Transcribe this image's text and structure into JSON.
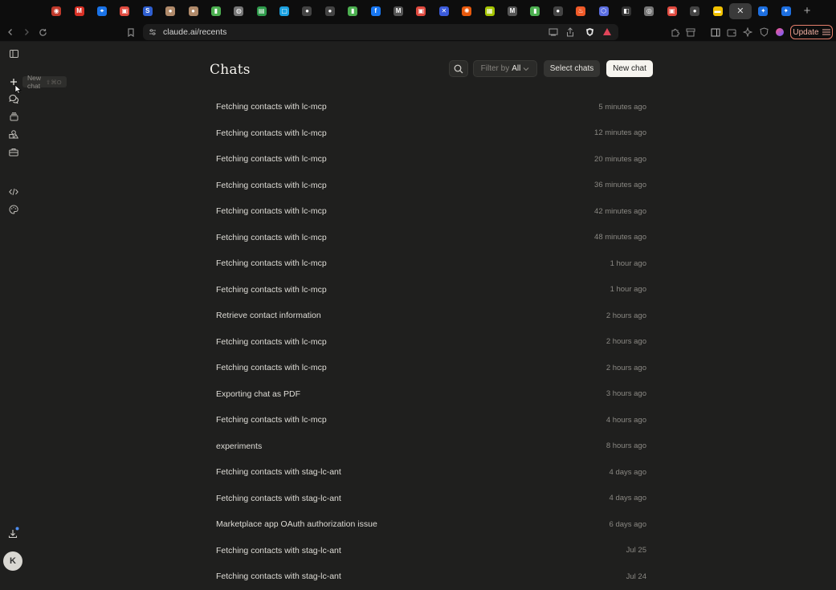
{
  "browser": {
    "url": "claude.ai/recents",
    "update_label": "Update",
    "tabs": [
      {
        "icon": "record-icon",
        "glyph": "◉",
        "color": "#c0392b"
      },
      {
        "icon": "gmail-icon",
        "glyph": "M",
        "color": "#d93025"
      },
      {
        "icon": "maps-pin-icon",
        "glyph": "⌖",
        "color": "#1a73e8"
      },
      {
        "icon": "calendar-icon",
        "glyph": "▣",
        "color": "#e04a3f"
      },
      {
        "icon": "doc-icon",
        "glyph": "S",
        "color": "#2f5fd0"
      },
      {
        "icon": "avatar-favicon-icon",
        "glyph": "●",
        "color": "#b08a6a"
      },
      {
        "icon": "avatar-favicon-icon",
        "glyph": "●",
        "color": "#b08a6a"
      },
      {
        "icon": "chart-icon",
        "glyph": "▮",
        "color": "#4caf50"
      },
      {
        "icon": "globe-icon",
        "glyph": "◍",
        "color": "#777777"
      },
      {
        "icon": "calculator-icon",
        "glyph": "▤",
        "color": "#2e9b4b"
      },
      {
        "icon": "chat-bubble-icon",
        "glyph": "▢",
        "color": "#1aa0e0"
      },
      {
        "icon": "github-icon",
        "glyph": "●",
        "color": "#444444"
      },
      {
        "icon": "github-icon",
        "glyph": "●",
        "color": "#444444"
      },
      {
        "icon": "chart-icon",
        "glyph": "▮",
        "color": "#4caf50"
      },
      {
        "icon": "facebook-icon",
        "glyph": "f",
        "color": "#1877f2"
      },
      {
        "icon": "medium-icon",
        "glyph": "M",
        "color": "#555555"
      },
      {
        "icon": "calendar-icon",
        "glyph": "▣",
        "color": "#e04a3f"
      },
      {
        "icon": "x-app-icon",
        "glyph": "✕",
        "color": "#3b5bdb"
      },
      {
        "icon": "gear-app-icon",
        "glyph": "✺",
        "color": "#e8590c"
      },
      {
        "icon": "sticky-icon",
        "glyph": "▦",
        "color": "#a4c400"
      },
      {
        "icon": "medium-icon",
        "glyph": "M",
        "color": "#555555"
      },
      {
        "icon": "chart-icon",
        "glyph": "▮",
        "color": "#4caf50"
      },
      {
        "icon": "github-icon",
        "glyph": "●",
        "color": "#444444"
      },
      {
        "icon": "fire-icon",
        "glyph": "♨",
        "color": "#f05a28"
      },
      {
        "icon": "hexagon-icon",
        "glyph": "⬡",
        "color": "#5b6ee1"
      },
      {
        "icon": "box-icon",
        "glyph": "◧",
        "color": "#333333"
      },
      {
        "icon": "chat-app-icon",
        "glyph": "◎",
        "color": "#777777"
      },
      {
        "icon": "calendar-icon",
        "glyph": "▣",
        "color": "#e04a3f"
      },
      {
        "icon": "github-icon",
        "glyph": "●",
        "color": "#444444"
      },
      {
        "icon": "note-icon",
        "glyph": "▬",
        "color": "#f2c200"
      },
      {
        "icon": "close-icon",
        "glyph": "✕",
        "color": "#3a3a3a",
        "active": true
      },
      {
        "icon": "settings-app-icon",
        "glyph": "✦",
        "color": "#1d6fe0"
      },
      {
        "icon": "settings-app-icon",
        "glyph": "✦",
        "color": "#1d6fe0"
      }
    ]
  },
  "sidebar": {
    "tooltip_label": "New chat",
    "tooltip_shortcut": "⇧⌘O",
    "avatar_initial": "K"
  },
  "page": {
    "title": "Chats",
    "filter_prefix": "Filter by",
    "filter_value": "All",
    "select_label": "Select chats",
    "new_chat_label": "New chat"
  },
  "chats": [
    {
      "name": "Fetching contacts with lc-mcp",
      "time": "5 minutes ago"
    },
    {
      "name": "Fetching contacts with lc-mcp",
      "time": "12 minutes ago"
    },
    {
      "name": "Fetching contacts with lc-mcp",
      "time": "20 minutes ago"
    },
    {
      "name": "Fetching contacts with lc-mcp",
      "time": "36 minutes ago"
    },
    {
      "name": "Fetching contacts with lc-mcp",
      "time": "42 minutes ago"
    },
    {
      "name": "Fetching contacts with lc-mcp",
      "time": "48 minutes ago"
    },
    {
      "name": "Fetching contacts with lc-mcp",
      "time": "1 hour ago"
    },
    {
      "name": "Fetching contacts with lc-mcp",
      "time": "1 hour ago"
    },
    {
      "name": "Retrieve contact information",
      "time": "2 hours ago"
    },
    {
      "name": "Fetching contacts with lc-mcp",
      "time": "2 hours ago"
    },
    {
      "name": "Fetching contacts with lc-mcp",
      "time": "2 hours ago"
    },
    {
      "name": "Exporting chat as PDF",
      "time": "3 hours ago"
    },
    {
      "name": "Fetching contacts with lc-mcp",
      "time": "4 hours ago"
    },
    {
      "name": "experiments",
      "time": "8 hours ago"
    },
    {
      "name": "Fetching contacts with stag-lc-ant",
      "time": "4 days ago"
    },
    {
      "name": "Fetching contacts with stag-lc-ant",
      "time": "4 days ago"
    },
    {
      "name": "Marketplace app OAuth authorization issue",
      "time": "6 days ago"
    },
    {
      "name": "Fetching contacts with stag-lc-ant",
      "time": "Jul 25"
    },
    {
      "name": "Fetching contacts with stag-lc-ant",
      "time": "Jul 24"
    }
  ]
}
